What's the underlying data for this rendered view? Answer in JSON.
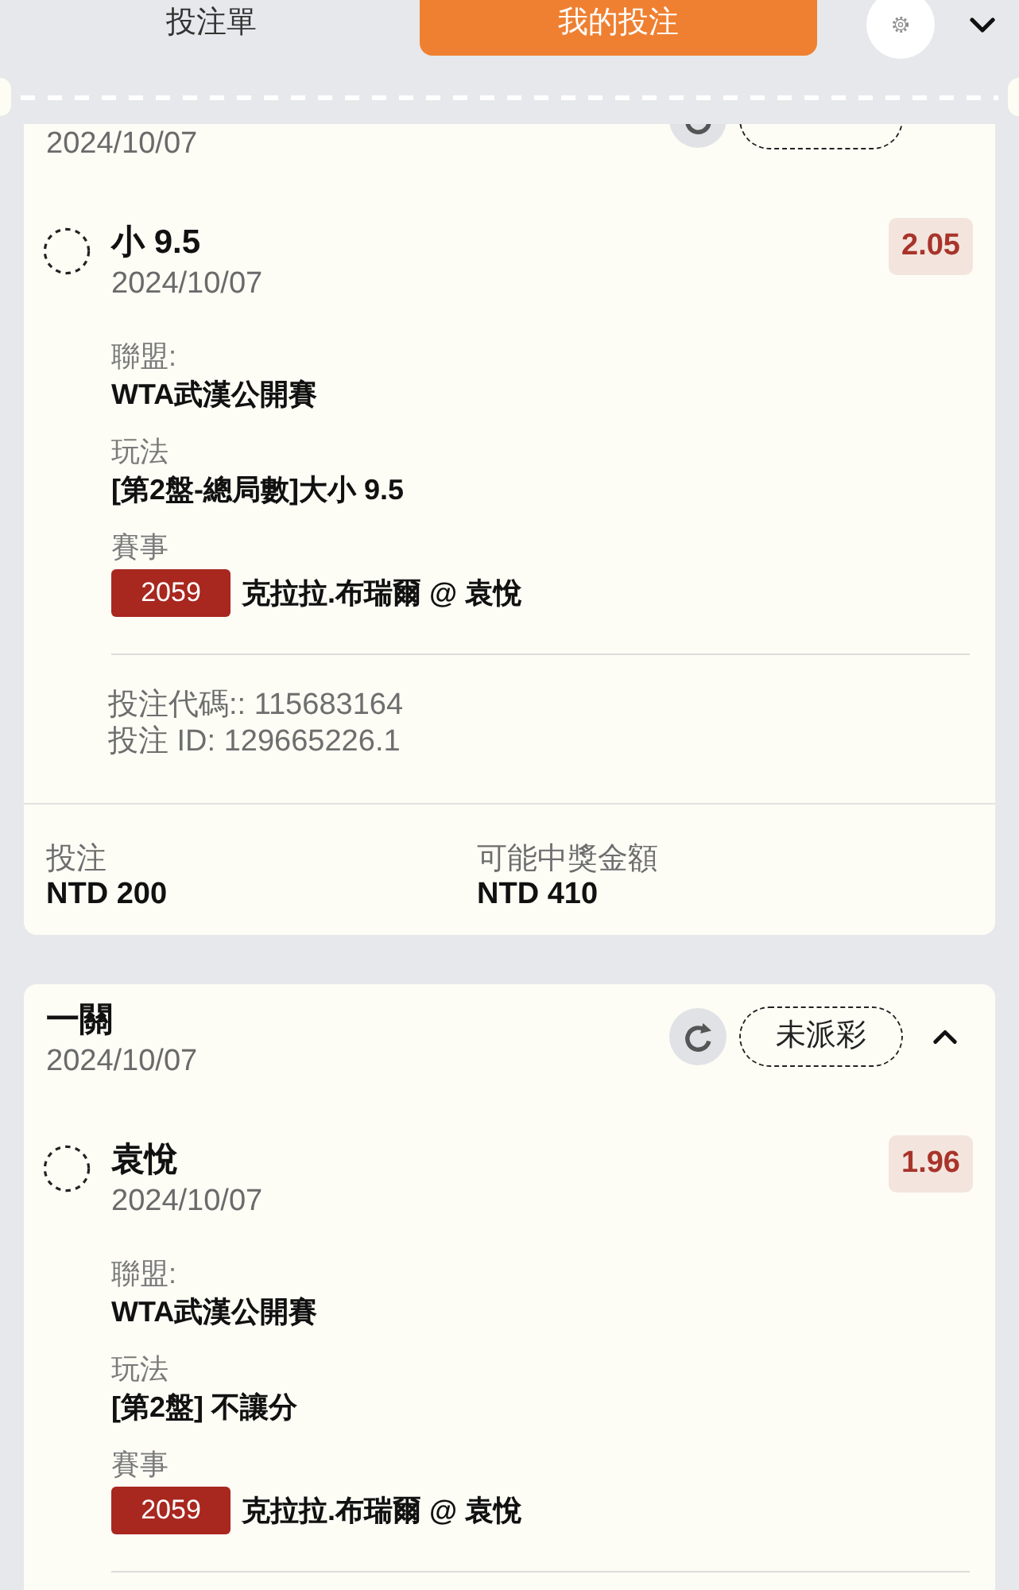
{
  "tabs": [
    {
      "label": "投注單",
      "selected": false
    },
    {
      "label": "我的投注",
      "selected": true
    }
  ],
  "bets": [
    {
      "date": "2024/10/07",
      "selections": [
        {
          "pick": "小 9.5",
          "date": "2024/10/07",
          "odds": "2.05",
          "details": [
            {
              "kind": "text",
              "label": "聯盟:",
              "value": "WTA武漢公開賽"
            },
            {
              "kind": "text",
              "label": "玩法",
              "value": "[第2盤-總局數]大小 9.5"
            },
            {
              "kind": "event",
              "label": "賽事",
              "event_id": "2059",
              "value": "克拉拉.布瑞爾 @ 袁悅"
            }
          ],
          "codes": [
            "投注代碼:: 115683164",
            "投注 ID: 129665226.1"
          ]
        }
      ],
      "summary": [
        {
          "label": "投注",
          "value": "NTD 200"
        },
        {
          "label": "可能中獎金額",
          "value": "NTD 410"
        }
      ]
    },
    {
      "title": "一關",
      "date": "2024/10/07",
      "status": "未派彩",
      "expanded": true,
      "selections": [
        {
          "pick": "袁悅",
          "date": "2024/10/07",
          "odds": "1.96",
          "details": [
            {
              "kind": "text",
              "label": "聯盟:",
              "value": "WTA武漢公開賽"
            },
            {
              "kind": "text",
              "label": "玩法",
              "value": "[第2盤] 不讓分"
            },
            {
              "kind": "event",
              "label": "賽事",
              "event_id": "2059",
              "value": "克拉拉.布瑞爾 @ 袁悅"
            }
          ]
        }
      ]
    }
  ]
}
